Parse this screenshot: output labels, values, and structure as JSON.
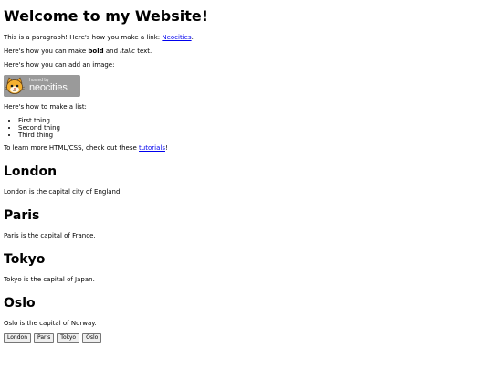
{
  "header": {
    "title": "Welcome to my Website!"
  },
  "intro": {
    "link_prefix": "This is a paragraph! Here's how you make a link: ",
    "link_label": "Neocities",
    "link_suffix": ".",
    "format_prefix": "Here's how you can make ",
    "bold_word": "bold",
    "format_and": " and ",
    "italic_word": "italic",
    "format_suffix": " text.",
    "image_text": "Here's how you can add an image:",
    "list_text": "Here's how to make a list:"
  },
  "badge": {
    "hosted_text": "hosted by",
    "brand_text": "neocities",
    "icon": "neocities-cat-icon"
  },
  "list_items": [
    "First thing",
    "Second thing",
    "Third thing"
  ],
  "learn": {
    "prefix": "To learn more HTML/CSS, check out these ",
    "link_label": "tutorials",
    "suffix": "!"
  },
  "cities": [
    {
      "name": "London",
      "text": "London is the capital city of England."
    },
    {
      "name": "Paris",
      "text": "Paris is the capital of France."
    },
    {
      "name": "Tokyo",
      "text": "Tokyo is the capital of Japan."
    },
    {
      "name": "Oslo",
      "text": "Oslo is the capital of Norway."
    }
  ],
  "buttons": [
    "London",
    "Paris",
    "Tokyo",
    "Oslo"
  ],
  "colors": {
    "link": "#0000ee",
    "badge_bg": "#9a9a9a"
  }
}
